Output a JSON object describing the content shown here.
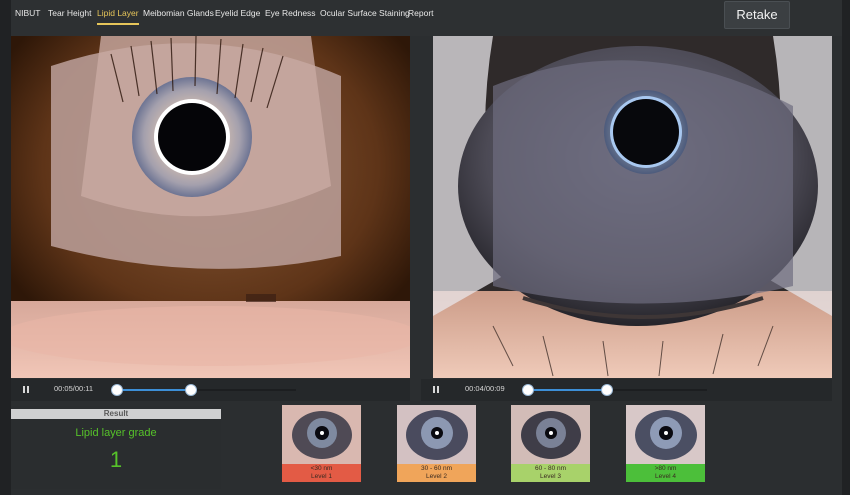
{
  "nav": {
    "tabs": [
      {
        "label": "NIBUT",
        "active": false
      },
      {
        "label": "Tear Height",
        "active": false
      },
      {
        "label": "Lipid Layer",
        "active": true
      },
      {
        "label": "Meibomian Glands",
        "active": false
      },
      {
        "label": "Eyelid Edge",
        "active": false
      },
      {
        "label": "Eye Redness",
        "active": false
      },
      {
        "label": "Ocular Surface Staining",
        "active": false
      },
      {
        "label": "Report",
        "active": false
      }
    ],
    "retake_label": "Retake",
    "accent_color": "#e6c55a"
  },
  "players": {
    "left": {
      "time": "00:05/00:11"
    },
    "right": {
      "time": "00:04/00:09"
    }
  },
  "result": {
    "header": "Result",
    "grade_label": "Lipid layer grade",
    "grade_value": "1",
    "grade_color": "#56c22a"
  },
  "references": [
    {
      "range": "<30 nm",
      "level": "Level 1",
      "color": "#e35b45"
    },
    {
      "range": "30 - 60 nm",
      "level": "Level 2",
      "color": "#f0a55a"
    },
    {
      "range": "60 - 80 nm",
      "level": "Level 3",
      "color": "#a8d26a"
    },
    {
      "range": ">80 nm",
      "level": "Level 4",
      "color": "#4cbf3a"
    }
  ]
}
